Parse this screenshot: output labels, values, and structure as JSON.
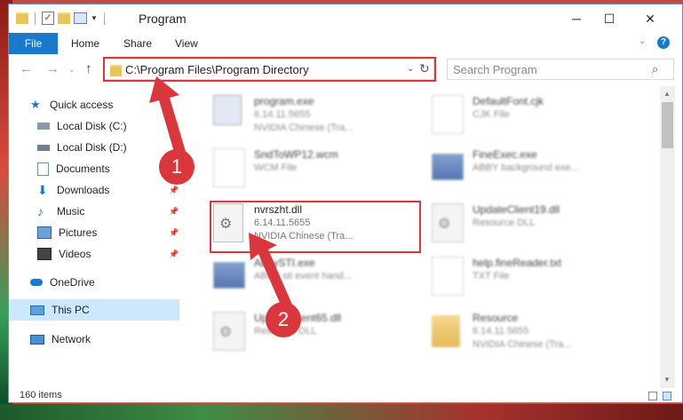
{
  "window": {
    "title": "Program",
    "controls": {
      "minimize": "─",
      "maximize": "☐",
      "close": "✕"
    }
  },
  "ribbon": {
    "file_tab": "File",
    "tabs": [
      "Home",
      "Share",
      "View"
    ],
    "help": "?"
  },
  "address_bar": {
    "path": "C:\\Program Files\\Program Directory",
    "search_placeholder": "Search Program"
  },
  "sidebar": {
    "quick_access": "Quick access",
    "items": [
      {
        "label": "Local Disk (C:)",
        "icon": "drive-icon",
        "pinned": true
      },
      {
        "label": "Local Disk (D:)",
        "icon": "drive-icon",
        "pinned": false
      },
      {
        "label": "Documents",
        "icon": "documents-icon",
        "pinned": true
      },
      {
        "label": "Downloads",
        "icon": "downloads-icon",
        "pinned": true
      },
      {
        "label": "Music",
        "icon": "music-icon",
        "pinned": true
      },
      {
        "label": "Pictures",
        "icon": "pictures-icon",
        "pinned": true
      },
      {
        "label": "Videos",
        "icon": "videos-icon",
        "pinned": true
      }
    ],
    "onedrive": "OneDrive",
    "this_pc": "This PC",
    "network": "Network"
  },
  "files": [
    {
      "name": "program.exe",
      "line2": "6.14.11.5655",
      "line3": "NVIDIA Chinese (Tra...",
      "kind": "exe"
    },
    {
      "name": "DefaultFont.cjk",
      "line2": "CJK File",
      "line3": "",
      "kind": "doc"
    },
    {
      "name": "SndToWP12.wcm",
      "line2": "WCM File",
      "line3": "",
      "kind": "doc"
    },
    {
      "name": "FineExec.exe",
      "line2": "ABBY background exe...",
      "line3": "",
      "kind": "exe"
    },
    {
      "name": "nvrszht.dll",
      "line2": "6.14.11.5655",
      "line3": "NVIDIA Chinese (Tra...",
      "kind": "dll"
    },
    {
      "name": "UpdateClient19.dll",
      "line2": "Resource DLL",
      "line3": "",
      "kind": "dll"
    },
    {
      "name": "AbbySTI.exe",
      "line2": "ABBY sti event hand...",
      "line3": "",
      "kind": "exe"
    },
    {
      "name": "help.fineReader.txt",
      "line2": "TXT File",
      "line3": "",
      "kind": "doc"
    },
    {
      "name": "UpdateClient65.dll",
      "line2": "Resource DLL",
      "line3": "",
      "kind": "dll"
    },
    {
      "name": "Resource",
      "line2": "6.14.11.5655",
      "line3": "NVIDIA Chinese (Tra...",
      "kind": "folder"
    }
  ],
  "status": {
    "item_count": "160 items"
  },
  "annotations": {
    "step1": "1",
    "step2": "2"
  },
  "colors": {
    "accent": "#1979ca",
    "highlight": "#d9363e",
    "selection": "#cce8ff"
  }
}
